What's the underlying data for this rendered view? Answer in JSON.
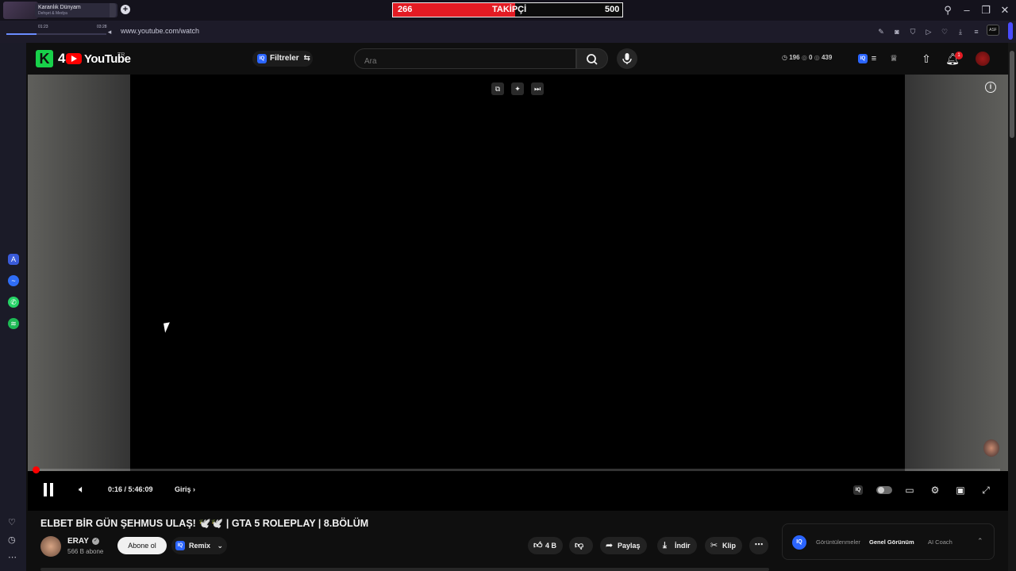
{
  "browser": {
    "tab_title": "Karanlık Dünyam",
    "tab_subtitle": "Dehşet & Medya",
    "media_time_left": "01:23",
    "media_time_right": "03:28",
    "url": "www.youtube.com/watch",
    "badge": "ASF"
  },
  "follower_goal": {
    "current": "266",
    "label": "TAKİPÇİ",
    "target": "500",
    "progress": 0.532,
    "fill_color": "#e31b23"
  },
  "header": {
    "logo_text": "4",
    "brand": "YouTube",
    "country": "TR",
    "filter_label": "Filtreler",
    "search_placeholder": "Ara",
    "stats": {
      "time": "196",
      "views1": "0",
      "views2": "439"
    },
    "notification_count": "1"
  },
  "player": {
    "time_current": "0:16",
    "time_total": "5:46:09",
    "time_display": "0:16 / 5:46:09",
    "chapter": "Giriş",
    "progress": 0.0008
  },
  "video": {
    "title": "ELBET BİR GÜN ŞEHMUS ULAŞ! 🕊️🕊️ | GTA 5 ROLEPLAY | 8.BÖLÜM",
    "channel": "ERAY",
    "subscribers": "566 B abone",
    "subscribe_label": "Abone ol",
    "remix_label": "Remix",
    "likes": "4 B",
    "share_label": "Paylaş",
    "download_label": "İndir",
    "clip_label": "Klip"
  },
  "iq_panel": {
    "tabs": [
      "Görüntülenmeler",
      "Genel Görünüm",
      "AI Coach"
    ],
    "active_tab": "Genel Görünüm"
  },
  "colors": {
    "accent_red": "#ff0000",
    "iq_blue": "#2b65ff",
    "k_green": "#18d14a"
  }
}
